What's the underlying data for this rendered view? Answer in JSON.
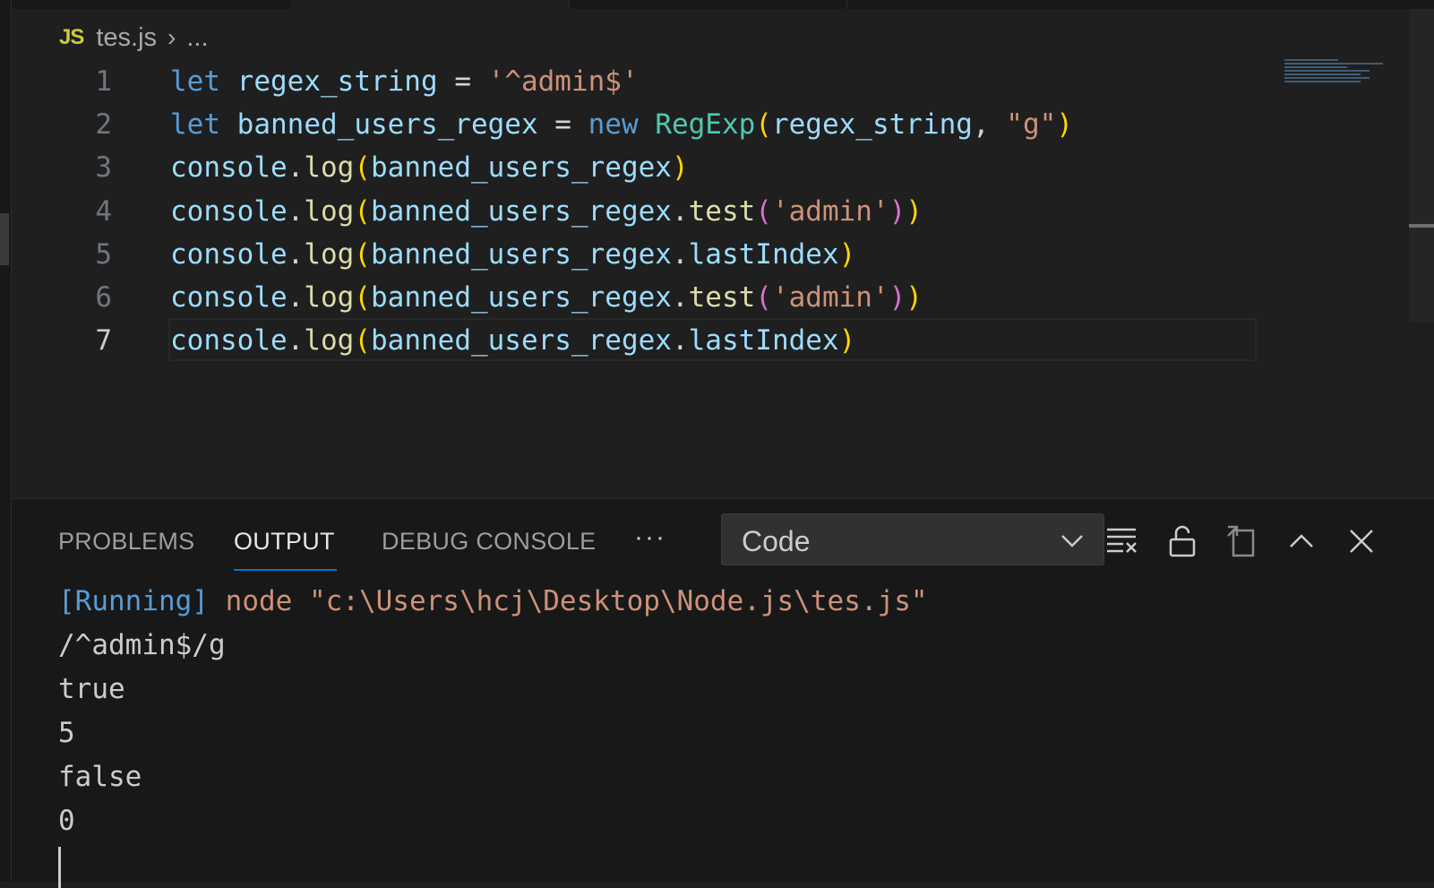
{
  "breadcrumb": {
    "lang_badge": "JS",
    "file": "tes.js",
    "more": "..."
  },
  "editor": {
    "line_numbers": [
      "1",
      "2",
      "3",
      "4",
      "5",
      "6",
      "7"
    ],
    "active_line": 7,
    "tokens": {
      "l1": [
        "let",
        "regex_string",
        "=",
        "'^admin$'"
      ],
      "l2": [
        "let",
        "banned_users_regex",
        "=",
        "new",
        "RegExp",
        "(",
        "regex_string",
        ",",
        "\"g\"",
        ")"
      ],
      "l3": [
        "console",
        ".",
        "log",
        "(",
        "banned_users_regex",
        ")"
      ],
      "l4": [
        "console",
        ".",
        "log",
        "(",
        "banned_users_regex",
        ".",
        "test",
        "(",
        "'admin'",
        ")",
        ")"
      ],
      "l5": [
        "console",
        ".",
        "log",
        "(",
        "banned_users_regex",
        ".",
        "lastIndex",
        ")"
      ],
      "l6": [
        "console",
        ".",
        "log",
        "(",
        "banned_users_regex",
        ".",
        "test",
        "(",
        "'admin'",
        ")",
        ")"
      ],
      "l7": [
        "console",
        ".",
        "log",
        "(",
        "banned_users_regex",
        ".",
        "lastIndex",
        ")"
      ]
    }
  },
  "panel": {
    "tabs": {
      "problems": "PROBLEMS",
      "output": "OUTPUT",
      "debug_console": "DEBUG CONSOLE"
    },
    "more": "···",
    "channel": "Code",
    "output": {
      "running_tag": "[Running]",
      "command": "node \"c:\\Users\\hcj\\Desktop\\Node.js\\tes.js\"",
      "lines": [
        "/^admin$/g",
        "true",
        "5",
        "false",
        "0"
      ]
    },
    "icons": [
      "clear-output-icon",
      "lock-icon",
      "open-in-editor-icon",
      "maximize-panel-icon",
      "close-icon"
    ]
  },
  "colors": {
    "keyword": "#569cd6",
    "variable": "#9cdcfe",
    "string": "#ce9178",
    "class": "#4ec9b0",
    "function": "#dcdcaa",
    "bracket1": "#ffd700",
    "bracket2": "#da70d6",
    "accent": "#0078d4"
  }
}
